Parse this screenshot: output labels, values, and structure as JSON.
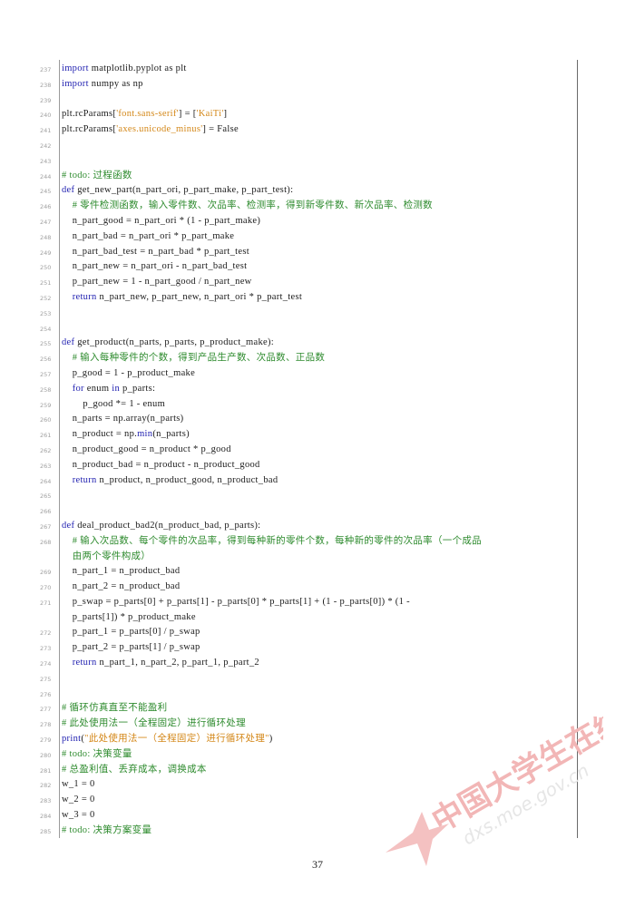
{
  "page": {
    "number": "37",
    "watermark": {
      "cn": "中国大学生在线",
      "url": "dxs.moe.gov.cn",
      "color": "#f2b6b6"
    }
  },
  "code": {
    "lines": [
      {
        "n": "237",
        "segs": [
          {
            "t": "import",
            "c": "kw"
          },
          {
            "t": " matplotlib.pyplot as plt",
            "c": ""
          }
        ]
      },
      {
        "n": "238",
        "segs": [
          {
            "t": "import",
            "c": "kw"
          },
          {
            "t": " numpy as np",
            "c": ""
          }
        ]
      },
      {
        "n": "239",
        "segs": []
      },
      {
        "n": "240",
        "segs": [
          {
            "t": "plt.rcParams[",
            "c": ""
          },
          {
            "t": "'font.sans-serif'",
            "c": "st"
          },
          {
            "t": "] = [",
            "c": ""
          },
          {
            "t": "'KaiTi'",
            "c": "st"
          },
          {
            "t": "]",
            "c": ""
          }
        ]
      },
      {
        "n": "241",
        "segs": [
          {
            "t": "plt.rcParams[",
            "c": ""
          },
          {
            "t": "'axes.unicode_minus'",
            "c": "st"
          },
          {
            "t": "] = False",
            "c": ""
          }
        ]
      },
      {
        "n": "242",
        "segs": []
      },
      {
        "n": "243",
        "segs": []
      },
      {
        "n": "244",
        "segs": [
          {
            "t": "# todo: 过程函数",
            "c": "cm"
          }
        ]
      },
      {
        "n": "245",
        "segs": [
          {
            "t": "def",
            "c": "kw"
          },
          {
            "t": " get_new_part(n_part_ori, p_part_make, p_part_test):",
            "c": ""
          }
        ]
      },
      {
        "n": "246",
        "segs": [
          {
            "t": "    # 零件检测函数，输入零件数、次品率、检测率，得到新零件数、新次品率、检测数",
            "c": "cm"
          }
        ]
      },
      {
        "n": "247",
        "segs": [
          {
            "t": "    n_part_good = n_part_ori * (1 - p_part_make)",
            "c": ""
          }
        ]
      },
      {
        "n": "248",
        "segs": [
          {
            "t": "    n_part_bad = n_part_ori * p_part_make",
            "c": ""
          }
        ]
      },
      {
        "n": "249",
        "segs": [
          {
            "t": "    n_part_bad_test = n_part_bad * p_part_test",
            "c": ""
          }
        ]
      },
      {
        "n": "250",
        "segs": [
          {
            "t": "    n_part_new = n_part_ori - n_part_bad_test",
            "c": ""
          }
        ]
      },
      {
        "n": "251",
        "segs": [
          {
            "t": "    p_part_new = 1 - n_part_good / n_part_new",
            "c": ""
          }
        ]
      },
      {
        "n": "252",
        "segs": [
          {
            "t": "    ",
            "c": ""
          },
          {
            "t": "return",
            "c": "kw"
          },
          {
            "t": " n_part_new, p_part_new, n_part_ori * p_part_test",
            "c": ""
          }
        ]
      },
      {
        "n": "253",
        "segs": []
      },
      {
        "n": "254",
        "segs": []
      },
      {
        "n": "255",
        "segs": [
          {
            "t": "def",
            "c": "kw"
          },
          {
            "t": " get_product(n_parts, p_parts, p_product_make):",
            "c": ""
          }
        ]
      },
      {
        "n": "256",
        "segs": [
          {
            "t": "    # 输入每种零件的个数，得到产品生产数、次品数、正品数",
            "c": "cm"
          }
        ]
      },
      {
        "n": "257",
        "segs": [
          {
            "t": "    p_good = 1 - p_product_make",
            "c": ""
          }
        ]
      },
      {
        "n": "258",
        "segs": [
          {
            "t": "    ",
            "c": ""
          },
          {
            "t": "for",
            "c": "kw"
          },
          {
            "t": " enum ",
            "c": ""
          },
          {
            "t": "in",
            "c": "kw"
          },
          {
            "t": " p_parts:",
            "c": ""
          }
        ]
      },
      {
        "n": "259",
        "segs": [
          {
            "t": "        p_good *= 1 - enum",
            "c": ""
          }
        ]
      },
      {
        "n": "260",
        "segs": [
          {
            "t": "    n_parts = np.array(n_parts)",
            "c": ""
          }
        ]
      },
      {
        "n": "261",
        "segs": [
          {
            "t": "    n_product = np.",
            "c": ""
          },
          {
            "t": "min",
            "c": "fn"
          },
          {
            "t": "(n_parts)",
            "c": ""
          }
        ]
      },
      {
        "n": "262",
        "segs": [
          {
            "t": "    n_product_good = n_product * p_good",
            "c": ""
          }
        ]
      },
      {
        "n": "263",
        "segs": [
          {
            "t": "    n_product_bad = n_product - n_product_good",
            "c": ""
          }
        ]
      },
      {
        "n": "264",
        "segs": [
          {
            "t": "    ",
            "c": ""
          },
          {
            "t": "return",
            "c": "kw"
          },
          {
            "t": " n_product, n_product_good, n_product_bad",
            "c": ""
          }
        ]
      },
      {
        "n": "265",
        "segs": []
      },
      {
        "n": "266",
        "segs": []
      },
      {
        "n": "267",
        "segs": [
          {
            "t": "def",
            "c": "kw"
          },
          {
            "t": " deal_product_bad2(n_product_bad, p_parts):",
            "c": ""
          }
        ]
      },
      {
        "n": "268",
        "wrap": true,
        "segs": [
          {
            "t": "    # 输入次品数、每个零件的次品率，得到每种新的零件个数，每种新的零件的次品率（一个成品\n    由两个零件构成）",
            "c": "cm"
          }
        ]
      },
      {
        "n": "269",
        "segs": [
          {
            "t": "    n_part_1 = n_product_bad",
            "c": ""
          }
        ]
      },
      {
        "n": "270",
        "segs": [
          {
            "t": "    n_part_2 = n_product_bad",
            "c": ""
          }
        ]
      },
      {
        "n": "271",
        "wrap": true,
        "segs": [
          {
            "t": "    p_swap = p_parts[0] + p_parts[1] - p_parts[0] * p_parts[1] + (1 - p_parts[0]) * (1 -\n    p_parts[1]) * p_product_make",
            "c": ""
          }
        ]
      },
      {
        "n": "272",
        "segs": [
          {
            "t": "    p_part_1 = p_parts[0] / p_swap",
            "c": ""
          }
        ]
      },
      {
        "n": "273",
        "segs": [
          {
            "t": "    p_part_2 = p_parts[1] / p_swap",
            "c": ""
          }
        ]
      },
      {
        "n": "274",
        "segs": [
          {
            "t": "    ",
            "c": ""
          },
          {
            "t": "return",
            "c": "kw"
          },
          {
            "t": " n_part_1, n_part_2, p_part_1, p_part_2",
            "c": ""
          }
        ]
      },
      {
        "n": "275",
        "segs": []
      },
      {
        "n": "276",
        "segs": []
      },
      {
        "n": "277",
        "segs": [
          {
            "t": "# 循环仿真直至不能盈利",
            "c": "cm"
          }
        ]
      },
      {
        "n": "278",
        "segs": [
          {
            "t": "# 此处使用法一（全程固定）进行循环处理",
            "c": "cm"
          }
        ]
      },
      {
        "n": "279",
        "segs": [
          {
            "t": "print",
            "c": "fn"
          },
          {
            "t": "(",
            "c": ""
          },
          {
            "t": "\"此处使用法一（全程固定）进行循环处理\"",
            "c": "st"
          },
          {
            "t": ")",
            "c": ""
          }
        ]
      },
      {
        "n": "280",
        "segs": [
          {
            "t": "# todo: 决策变量",
            "c": "cm"
          }
        ]
      },
      {
        "n": "281",
        "segs": [
          {
            "t": "# 总盈利值、丢弃成本，调换成本",
            "c": "cm"
          }
        ]
      },
      {
        "n": "282",
        "segs": [
          {
            "t": "w_1 = 0",
            "c": ""
          }
        ]
      },
      {
        "n": "283",
        "segs": [
          {
            "t": "w_2 = 0",
            "c": ""
          }
        ]
      },
      {
        "n": "284",
        "segs": [
          {
            "t": "w_3 = 0",
            "c": ""
          }
        ]
      },
      {
        "n": "285",
        "segs": [
          {
            "t": "# todo: 决策方案变量",
            "c": "cm"
          }
        ]
      }
    ]
  }
}
